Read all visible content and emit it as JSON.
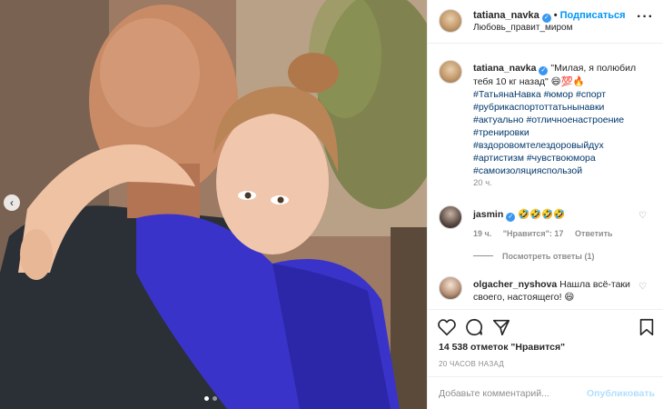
{
  "post": {
    "username": "tatiana_navka",
    "follow_label": "Подписаться",
    "location": "Любовь_правит_миром",
    "caption_text": "\"Милая, я полюбил тебя 10 кг назад\" 😄💯🔥",
    "hashtags": [
      "#ТатьянаНавка",
      "#юмор",
      "#спорт",
      "#рубрикаспортоттатьнынавки",
      "#актуально",
      "#отличноенастроение",
      "#тренировки",
      "#вздоровомтелездоровыйдух",
      "#артистизм",
      "#чувствоюмора",
      "#самоизоляцияспользой"
    ],
    "caption_time": "20 ч.",
    "likes": "14 538 отметок \"Нравится\"",
    "time_ago": "20 ЧАСОВ НАЗАД"
  },
  "comments": [
    {
      "username": "jasmin",
      "text": "🤣🤣🤣🤣",
      "time": "19 ч.",
      "likes": "\"Нравится\": 17",
      "reply_label": "Ответить",
      "view_replies": "Посмотреть ответы (1)"
    },
    {
      "username": "olgacher_nyshova",
      "text": "Нашла всё-таки своего, настоящего! 😄"
    }
  ],
  "comment_box": {
    "placeholder": "Добавьте комментарий...",
    "publish_label": "Опубликовать"
  },
  "icons": {
    "more": "more-options-icon",
    "like": "heart-icon",
    "comment": "comment-icon",
    "share": "share-icon",
    "save": "bookmark-icon",
    "verified": "verified-badge-icon"
  },
  "colors": {
    "accent": "#0095f6",
    "hashtag": "#00376b",
    "muted": "#8e8e8e"
  },
  "carousel": {
    "current": 1,
    "total": 2
  }
}
